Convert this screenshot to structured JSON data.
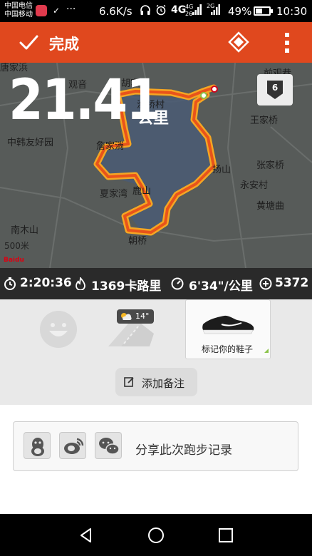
{
  "status_bar": {
    "carrier_1": "中国电信",
    "carrier_2": "中国移动",
    "more": "···",
    "net_speed": "6.6K/s",
    "net_4g": "4G",
    "net_4g_small": "4G",
    "net_2g_small": "2G",
    "net_26": "26",
    "battery": "49%",
    "battery_level": 0.49,
    "time": "10:30"
  },
  "app_bar": {
    "done_label": "完成"
  },
  "map": {
    "distance": "21.41",
    "distance_unit": "公里",
    "laps_badge": "6",
    "scale_label": "500米",
    "map_logo": "Baidu",
    "places": [
      {
        "name": "唐家浜"
      },
      {
        "name": "观音"
      },
      {
        "name": "胡家埼"
      },
      {
        "name": "渔桥村"
      },
      {
        "name": "中韩友好园"
      },
      {
        "name": "詹家淌"
      },
      {
        "name": "王家桥"
      },
      {
        "name": "扬山"
      },
      {
        "name": "张家桥"
      },
      {
        "name": "永安村"
      },
      {
        "name": "黄塘曲"
      },
      {
        "name": "夏家湾"
      },
      {
        "name": "鹿山"
      },
      {
        "name": "南木山"
      },
      {
        "name": "朝桥"
      },
      {
        "name": "前观巷"
      }
    ]
  },
  "stats": {
    "duration": "2:20:36",
    "calories": "1369卡路里",
    "pace": "6'34\"/公里",
    "fuel": "5372"
  },
  "gear": {
    "weather_temp": "14°",
    "shoe_label": "标记你的鞋子"
  },
  "note": {
    "label": "添加备注"
  },
  "share": {
    "label": "分享此次跑步记录"
  },
  "colors": {
    "app_bar": "#e0481e",
    "route_outer": "#f5a623",
    "route_inner": "#e8531b",
    "shoe_accent": "#8bc34a"
  }
}
